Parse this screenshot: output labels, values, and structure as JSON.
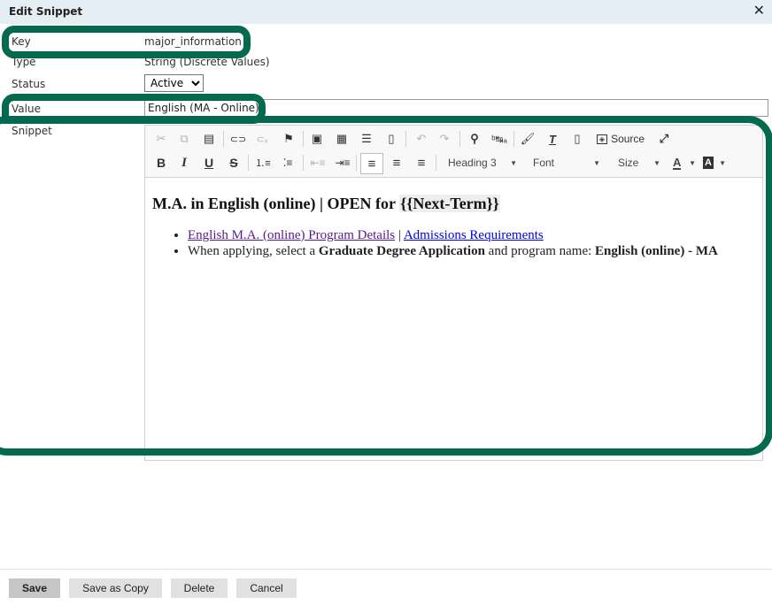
{
  "dialog": {
    "title": "Edit Snippet",
    "close_icon": "close-icon"
  },
  "form": {
    "key": {
      "label": "Key",
      "value": "major_information"
    },
    "type": {
      "label": "Type",
      "value": "String (Discrete Values)"
    },
    "status": {
      "label": "Status",
      "value": "Active"
    },
    "value": {
      "label": "Value",
      "value": "English (MA - Online)"
    },
    "snippet": {
      "label": "Snippet"
    }
  },
  "toolbar": {
    "row1": [
      {
        "name": "cut-icon",
        "glyph": "✂",
        "disabled": true
      },
      {
        "name": "copy-icon",
        "glyph": "⧉",
        "disabled": true
      },
      {
        "name": "paste-icon",
        "glyph": "📋",
        "disabled": false
      },
      {
        "name": "link-icon",
        "glyph": "⛓",
        "disabled": false
      },
      {
        "name": "unlink-icon",
        "glyph": "⛓",
        "disabled": true
      },
      {
        "name": "anchor-flag-icon",
        "glyph": "⚑",
        "disabled": false
      },
      {
        "name": "image-icon",
        "glyph": "▣",
        "disabled": false
      },
      {
        "name": "table-icon",
        "glyph": "▦",
        "disabled": false
      },
      {
        "name": "horizontal-line-icon",
        "glyph": "☰",
        "disabled": false
      },
      {
        "name": "page-break-icon",
        "glyph": "🗎",
        "disabled": false
      },
      {
        "name": "undo-icon",
        "glyph": "↶",
        "disabled": true
      },
      {
        "name": "redo-icon",
        "glyph": "↷",
        "disabled": true
      },
      {
        "name": "find-icon",
        "glyph": "🔍",
        "disabled": false
      },
      {
        "name": "replace-icon",
        "glyph": "ᵇ⇄ₐ",
        "disabled": false
      },
      {
        "name": "copy-format-icon",
        "glyph": "🖌",
        "disabled": false
      },
      {
        "name": "remove-format-icon",
        "glyph": "T̲ₓ",
        "disabled": false
      },
      {
        "name": "show-blocks-icon",
        "glyph": "▯",
        "disabled": false
      }
    ],
    "source_label": "Source",
    "maximize_icon": "maximize-icon",
    "row2": [
      {
        "name": "bold-icon",
        "glyph": "B"
      },
      {
        "name": "italic-icon",
        "glyph": "I"
      },
      {
        "name": "underline-icon",
        "glyph": "U"
      },
      {
        "name": "strikethrough-icon",
        "glyph": "S"
      },
      {
        "name": "numbered-list-icon",
        "glyph": "1≡"
      },
      {
        "name": "bulleted-list-icon",
        "glyph": "•≡"
      },
      {
        "name": "decrease-indent-icon",
        "glyph": "⇤≡"
      },
      {
        "name": "increase-indent-icon",
        "glyph": "⇥≡"
      },
      {
        "name": "align-left-icon",
        "glyph": "≡"
      },
      {
        "name": "align-center-icon",
        "glyph": "≡"
      },
      {
        "name": "align-right-icon",
        "glyph": "≡"
      }
    ],
    "format_combo": "Heading 3",
    "font_combo": "Font",
    "size_combo": "Size",
    "text_color_label": "A",
    "bg_color_label": "A"
  },
  "content": {
    "heading_prefix": "M.A. in English (online) | OPEN for ",
    "heading_placeholder": "{{Next-Term}}",
    "bullets": {
      "link1": "English M.A. (online) Program Details",
      "separator": " | ",
      "link2": "Admissions Requirements",
      "line2_prefix": "When applying, select a ",
      "line2_bold1": "Graduate Degree Application",
      "line2_mid": " and program name: ",
      "line2_bold2": "English (online) - MA"
    }
  },
  "buttons": {
    "save": "Save",
    "save_as_copy": "Save as Copy",
    "delete": "Delete",
    "cancel": "Cancel"
  },
  "colors": {
    "highlight_ring": "#03694f",
    "titlebar_bg": "#e6eef5"
  }
}
